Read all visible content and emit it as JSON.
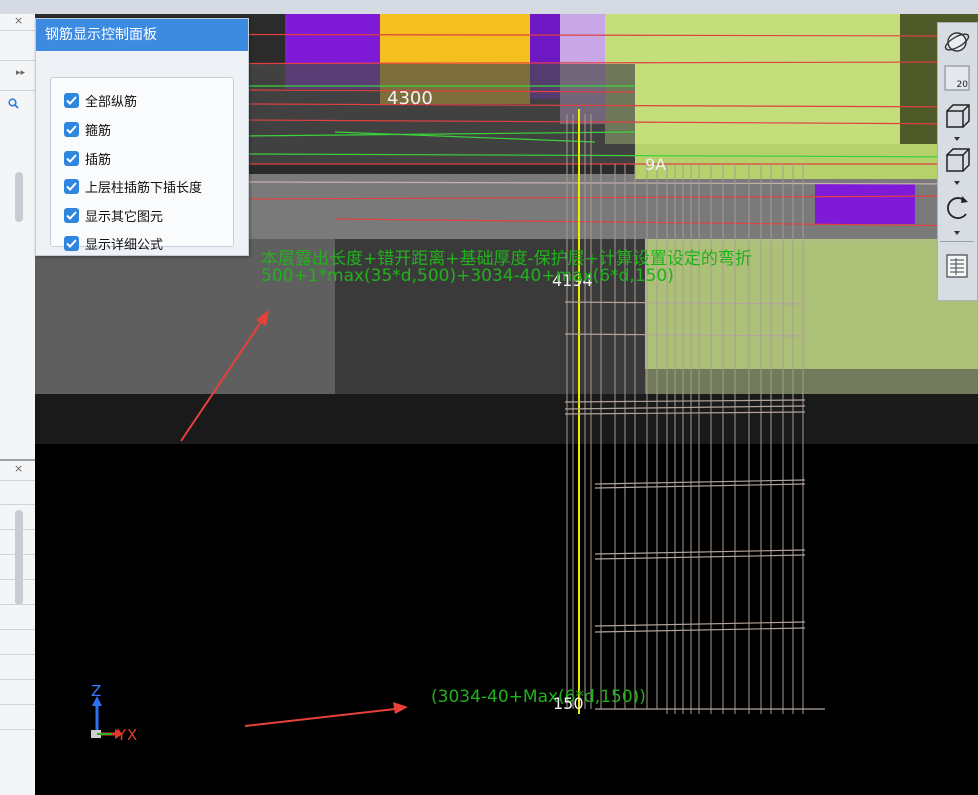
{
  "panel": {
    "title": "钢筋显示控制面板",
    "options": [
      {
        "label": "全部纵筋",
        "checked": true
      },
      {
        "label": "箍筋",
        "checked": true
      },
      {
        "label": "插筋",
        "checked": true
      },
      {
        "label": "上层柱插筋下插长度",
        "checked": true
      },
      {
        "label": "显示其它图元",
        "checked": true
      },
      {
        "label": "显示详细公式",
        "checked": true
      }
    ]
  },
  "viewport": {
    "dimension_labels": [
      "4300",
      "4194",
      "9A"
    ],
    "formula_description": "本层露出长度+错开距离+基础厚度-保护层+计算设置设定的弯折",
    "formula_expression": "500+1*max(35*d,500)+3034-40+max(6*d,150)",
    "bottom_formula": "(3034-40+Max(6*d,150))",
    "bottom_value": "150",
    "axis": {
      "z": "Z",
      "y": "Y",
      "x": "X"
    }
  },
  "toolbar": {
    "zoom_label": "20",
    "tools": [
      "orbit-icon",
      "zoom-icon",
      "view-3d-icon",
      "view-box-icon",
      "rotate-icon",
      "rebar-list-icon"
    ]
  },
  "colors": {
    "panel_header": "#3c8be0",
    "checkbox": "#2f86de",
    "formula_green": "#21b21b",
    "arrow_red": "#e8413a",
    "concrete_green": "#c4de7c",
    "purple": "#7f1bd8",
    "orange": "#f4c01f"
  }
}
